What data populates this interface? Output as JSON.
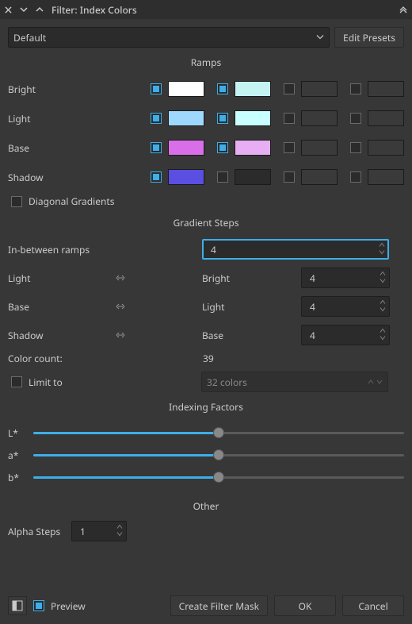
{
  "window": {
    "title": "Filter: Index Colors"
  },
  "preset": {
    "value": "Default",
    "edit": "Edit Presets"
  },
  "sections": {
    "ramps": "Ramps",
    "gradient": "Gradient Steps",
    "indexing": "Indexing Factors",
    "other": "Other"
  },
  "ramps": [
    {
      "label": "Bright",
      "cells": [
        {
          "on": true,
          "color": "#ffffff"
        },
        {
          "on": true,
          "color": "#c4f3f2"
        },
        {
          "on": false,
          "color": "#3a3a3a"
        },
        {
          "on": false,
          "color": "#3a3a3a"
        }
      ]
    },
    {
      "label": "Light",
      "cells": [
        {
          "on": true,
          "color": "#9fd8ff"
        },
        {
          "on": true,
          "color": "#c8ffff"
        },
        {
          "on": false,
          "color": "#3a3a3a"
        },
        {
          "on": false,
          "color": "#3a3a3a"
        }
      ]
    },
    {
      "label": "Base",
      "cells": [
        {
          "on": true,
          "color": "#d86fe8"
        },
        {
          "on": true,
          "color": "#e7aef3"
        },
        {
          "on": false,
          "color": "#3a3a3a"
        },
        {
          "on": false,
          "color": "#3a3a3a"
        }
      ]
    },
    {
      "label": "Shadow",
      "cells": [
        {
          "on": true,
          "color": "#5a4fe0"
        },
        {
          "on": false,
          "color": "#2b2b2b"
        },
        {
          "on": false,
          "color": "#3a3a3a"
        },
        {
          "on": false,
          "color": "#3a3a3a"
        }
      ]
    }
  ],
  "diagonal": {
    "on": false,
    "label": "Diagonal Gradients"
  },
  "gradient": {
    "in_between_label": "In-between ramps",
    "in_between_value": "4",
    "pairs": [
      {
        "left": "Light",
        "right": "Bright",
        "value": "4"
      },
      {
        "left": "Base",
        "right": "Light",
        "value": "4"
      },
      {
        "left": "Shadow",
        "right": "Base",
        "value": "4"
      }
    ]
  },
  "color_count": {
    "label": "Color count:",
    "value": "39"
  },
  "limit": {
    "on": false,
    "label": "Limit to",
    "combo": "32 colors"
  },
  "indexing": [
    {
      "label": "L*",
      "value": 50
    },
    {
      "label": "a*",
      "value": 50
    },
    {
      "label": "b*",
      "value": 50
    }
  ],
  "alpha": {
    "label": "Alpha Steps",
    "value": "1"
  },
  "footer": {
    "preview_on": true,
    "preview": "Preview",
    "mask": "Create Filter Mask",
    "ok": "OK",
    "cancel": "Cancel"
  }
}
